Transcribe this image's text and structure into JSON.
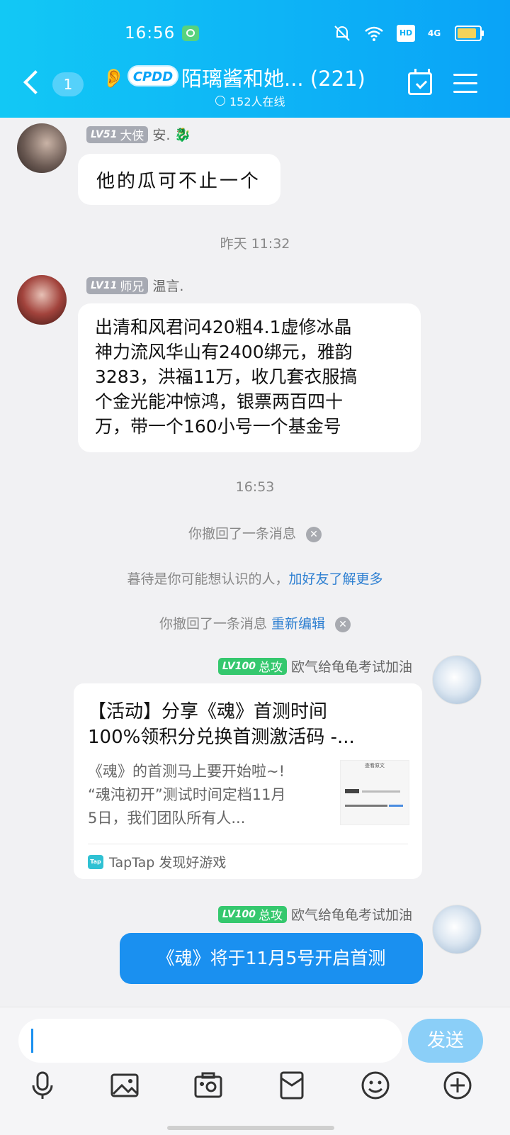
{
  "status_bar": {
    "time": "16:56",
    "network": "4G",
    "hd_label": "HD"
  },
  "header": {
    "unread_count": "1",
    "group_tag": "CPDD",
    "title": "陌璃酱和她... (221)",
    "online": "152人在线"
  },
  "messages": [
    {
      "level": "LV51",
      "rank": "大侠",
      "name": "安.",
      "text": "他的瓜可不止一个"
    },
    {
      "timestamp": "昨天 11:32"
    },
    {
      "level": "LV11",
      "rank": "师兄",
      "name": "温言.",
      "lines": [
        "出清和风君问420粗4.1虚修冰晶",
        "神力流风华山有2400绑元，雅韵",
        "3283，洪福11万，收几套衣服搞",
        "个金光能冲惊鸿，银票两百四十",
        "万，带一个160小号一个基金号"
      ]
    },
    {
      "timestamp": "16:53"
    }
  ],
  "system": {
    "recall_1": "你撤回了一条消息",
    "suggest_prefix": "暮待是你可能想认识的人，",
    "suggest_link": "加好友了解更多",
    "recall_2": "你撤回了一条消息",
    "reedit_link": "重新编辑"
  },
  "my_messages": {
    "level": "LV100",
    "rank": "总攻",
    "name": "欧气给龟龟考试加油",
    "card": {
      "title_line1": "【活动】分享《魂》首测时间",
      "title_line2": "100%领积分兑换首测激活码 -...",
      "desc_line1": "《魂》的首测马上要开始啦~!",
      "desc_line2": "“魂沌初开”测试时间定档11月",
      "desc_line3": "5日，我们团队所有人...",
      "thumb_title": "查看原文",
      "source_logo": "Tap",
      "source": "TapTap 发现好游戏"
    },
    "text": "《魂》将于11月5号开启首测"
  },
  "input_bar": {
    "send_label": "发送"
  },
  "icons": [
    "back-icon",
    "ear-icon",
    "calendar-icon",
    "menu-icon",
    "mic-icon",
    "image-icon",
    "camera-icon",
    "red-packet-icon",
    "emoji-icon",
    "plus-icon"
  ],
  "colors": {
    "header_start": "#12c8f5",
    "header_end": "#0aa3f7",
    "my_bubble": "#1a90f0",
    "link": "#2d7fd1",
    "lv_green": "#35c86e"
  }
}
